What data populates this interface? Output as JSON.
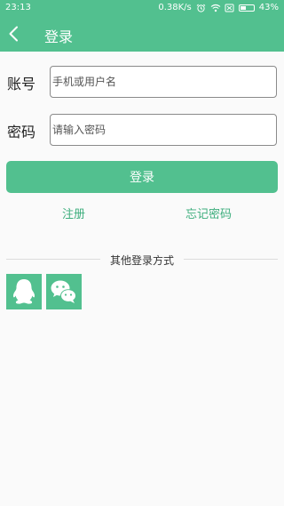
{
  "status_bar": {
    "time": "23:13",
    "speed": "0.38K/s",
    "battery": "43%",
    "battery_level": 0.43,
    "icons": [
      "alarm-icon",
      "wifi-icon",
      "sim-icon",
      "battery-icon"
    ]
  },
  "header": {
    "title": "登录",
    "back_icon": "back-chevron-icon"
  },
  "form": {
    "account_label": "账号",
    "account_placeholder": "手机或用户名",
    "account_value": "",
    "password_label": "密码",
    "password_placeholder": "请输入密码",
    "password_value": "",
    "login_button": "登录"
  },
  "links": {
    "register": "注册",
    "forgot_password": "忘记密码"
  },
  "other_login": {
    "label": "其他登录方式",
    "providers": [
      {
        "name": "QQ",
        "icon": "qq-icon"
      },
      {
        "name": "WeChat",
        "icon": "wechat-icon"
      }
    ]
  },
  "colors": {
    "accent": "#52c08f",
    "link": "#3eae7d",
    "background": "#fafafa"
  }
}
